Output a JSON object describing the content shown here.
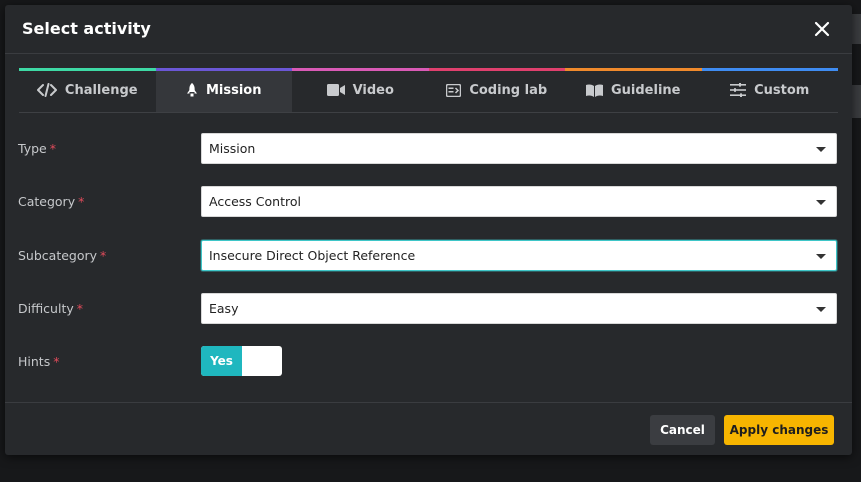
{
  "modal": {
    "title": "Select activity"
  },
  "tabs": [
    {
      "label": "Challenge",
      "icon": "code-icon",
      "color": "#3ed9a5",
      "active": false
    },
    {
      "label": "Mission",
      "icon": "rocket-icon",
      "color": "#6b57d6",
      "active": true
    },
    {
      "label": "Video",
      "icon": "video-camera-icon",
      "color": "#d95ab6",
      "active": false
    },
    {
      "label": "Coding lab",
      "icon": "terminal-icon",
      "color": "#e0406e",
      "active": false
    },
    {
      "label": "Guideline",
      "icon": "book-icon",
      "color": "#f08a2c",
      "active": false
    },
    {
      "label": "Custom",
      "icon": "sliders-icon",
      "color": "#3f8cf2",
      "active": false
    }
  ],
  "form": {
    "required_mark": "*",
    "type": {
      "label": "Type",
      "value": "Mission"
    },
    "category": {
      "label": "Category",
      "value": "Access Control"
    },
    "subcategory": {
      "label": "Subcategory",
      "value": "Insecure Direct Object Reference"
    },
    "difficulty": {
      "label": "Difficulty",
      "value": "Easy"
    },
    "hints": {
      "label": "Hints",
      "toggle_label": "Yes",
      "enabled": true
    }
  },
  "footer": {
    "cancel_label": "Cancel",
    "apply_label": "Apply changes"
  },
  "colors": {
    "accent": "#1fb7bf",
    "primary_button": "#f7b500",
    "required": "#e24b5b"
  }
}
